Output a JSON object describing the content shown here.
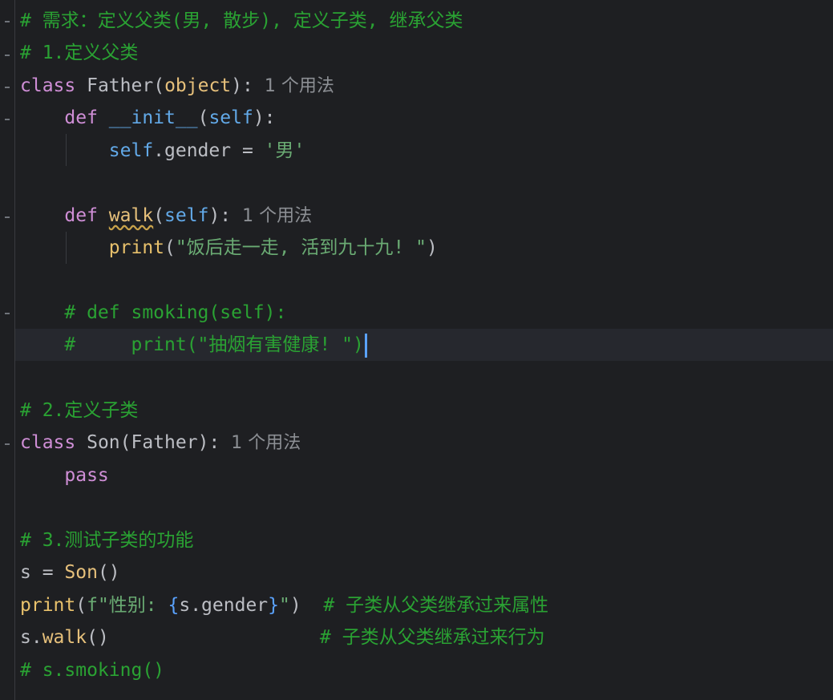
{
  "code": {
    "l1_comment": "# 需求：定义父类(男, 散步), 定义子类, 继承父类",
    "l2_comment": "# 1.定义父类",
    "l3_kw": "class",
    "l3_name": "Father",
    "l3_open": "(",
    "l3_base": "object",
    "l3_close": "):",
    "l3_hint": "1 个用法",
    "l4_kw": "def",
    "l4_name": "__init__",
    "l4_open": "(",
    "l4_self": "self",
    "l4_close": "):",
    "l5_self": "self",
    "l5_rest": ".gender = ",
    "l5_str": "'男'",
    "l7_kw": "def",
    "l7_name": "walk",
    "l7_open": "(",
    "l7_self": "self",
    "l7_close": "):",
    "l7_hint": "1 个用法",
    "l8_fn": "print",
    "l8_open": "(",
    "l8_str": "\"饭后走一走, 活到九十九! \"",
    "l8_close": ")",
    "l10_comment": "# def smoking(self):",
    "l11_comment": "#     print(\"抽烟有害健康! \")",
    "l13_comment": "# 2.定义子类",
    "l14_kw": "class",
    "l14_name": "Son",
    "l14_rest": "(Father):",
    "l14_hint": "1 个用法",
    "l15_kw": "pass",
    "l17_comment": "# 3.测试子类的功能",
    "l18_var": "s = ",
    "l18_cls": "Son",
    "l18_paren": "()",
    "l19_fn": "print",
    "l19_open": "(",
    "l19_str1": "f\"性别: ",
    "l19_b1": "{",
    "l19_expr": "s.gender",
    "l19_b2": "}",
    "l19_str2": "\"",
    "l19_close": ")",
    "l19_comment": "# 子类从父类继承过来属性",
    "l20_obj": "s.",
    "l20_fn": "walk",
    "l20_paren": "()",
    "l20_comment": "# 子类从父类继承过来行为",
    "l21_comment": "# s.smoking()"
  },
  "colors": {
    "background": "#1e1f22",
    "comment": "#2aa233",
    "keyword": "#cf8ed6",
    "function": "#e6c07b",
    "self": "#62a9e8",
    "string": "#6aab73",
    "caret": "#5aa2ff"
  }
}
